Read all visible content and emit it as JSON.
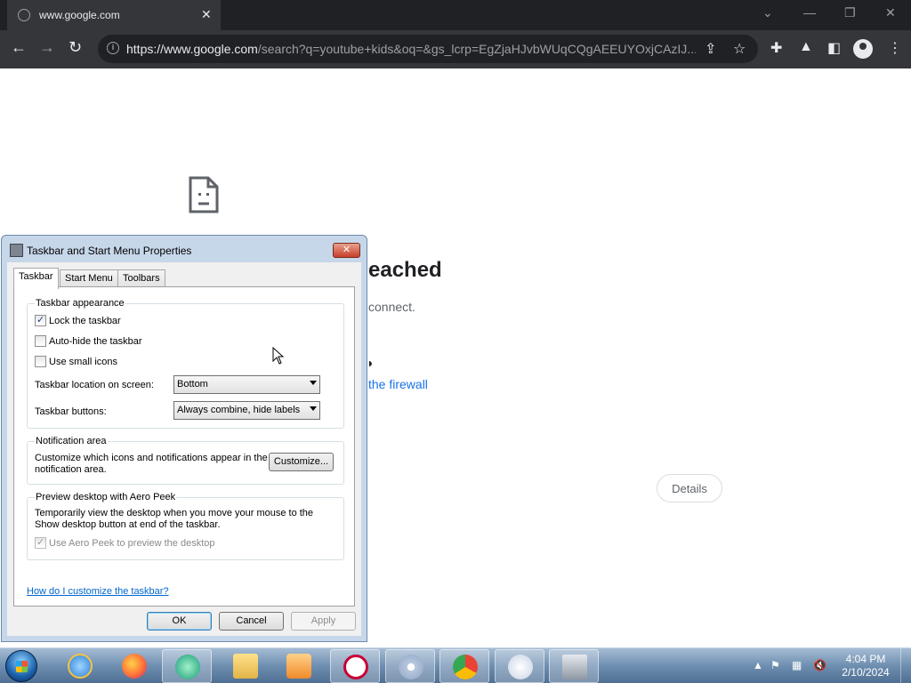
{
  "browser": {
    "tab_title": "www.google.com",
    "url_host": "https://www.google.com",
    "url_rest": "/search?q=youtube+kids&oq=&gs_lcrp=EgZjaHJvbWUqCQgAEEUYOxjCAzIJ..."
  },
  "page": {
    "heading": "eached",
    "subtext": "connect.",
    "link_text": "the firewall",
    "details_label": "Details"
  },
  "dialog": {
    "title": "Taskbar and Start Menu Properties",
    "close_label": "✕",
    "tabs": [
      {
        "label": "Taskbar"
      },
      {
        "label": "Start Menu"
      },
      {
        "label": "Toolbars"
      }
    ],
    "appearance": {
      "label": "Taskbar appearance",
      "lock_label": "Lock the taskbar",
      "autohide_label": "Auto-hide the taskbar",
      "small_icons_label": "Use small icons",
      "location_label": "Taskbar location on screen:",
      "location_value": "Bottom",
      "buttons_label": "Taskbar buttons:",
      "buttons_value": "Always combine, hide labels"
    },
    "notification": {
      "label": "Notification area",
      "text_line1": "Customize which icons and notifications appear in the",
      "text_line2": "notification area.",
      "customize_label": "Customize..."
    },
    "aero": {
      "label": "Preview desktop with Aero Peek",
      "text_line1": "Temporarily view the desktop when you move your mouse to the",
      "text_line2": "Show desktop button at end of the taskbar.",
      "checkbox_label": "Use Aero Peek to preview the desktop"
    },
    "help_link": "How do I customize the taskbar?",
    "ok_label": "OK",
    "cancel_label": "Cancel",
    "apply_label": "Apply"
  },
  "taskbar": {
    "time": "4:04 PM",
    "date": "2/10/2024"
  },
  "colors": {
    "chrome_dark": "#202124",
    "chrome_toolbar": "#35363a",
    "link_blue": "#1a73e8",
    "win_link": "#0066cc"
  }
}
